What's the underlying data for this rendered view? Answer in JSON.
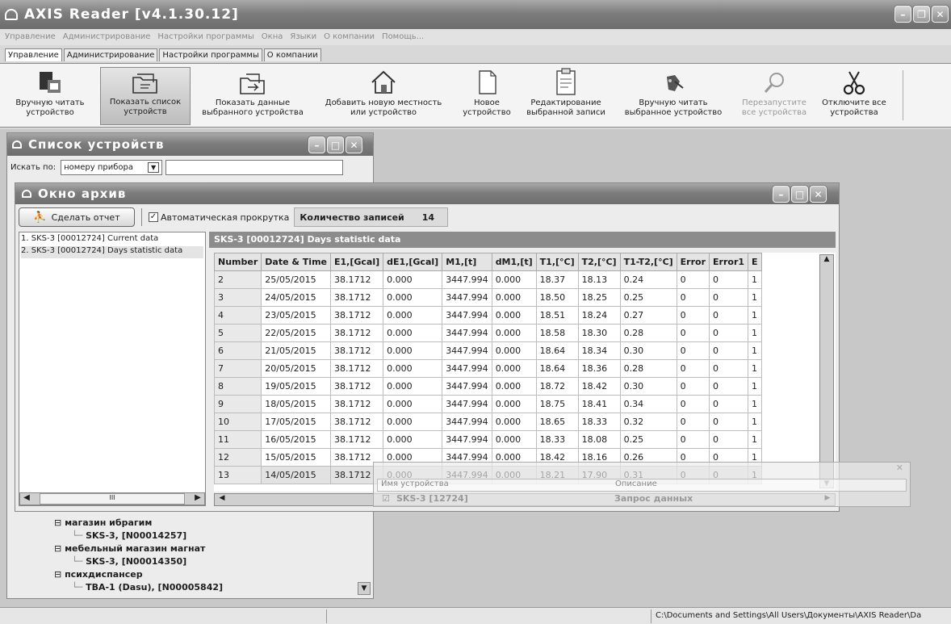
{
  "app": {
    "title": "AXIS Reader [v4.1.30.12]"
  },
  "menu": [
    "Управление",
    "Администрирование",
    "Настройки программы",
    "Окна",
    "Языки",
    "О компании",
    "Помощь..."
  ],
  "tabs": [
    "Управление",
    "Администрирование",
    "Настройки программы",
    "О компании"
  ],
  "toolbar": [
    {
      "l1": "Вручную читать",
      "l2": "устройство",
      "icon": "device-icon",
      "state": "normal"
    },
    {
      "l1": "Показать список",
      "l2": "устройств",
      "icon": "folder-list-icon",
      "state": "selected"
    },
    {
      "l1": "Показать данные",
      "l2": "выбранного устройства",
      "icon": "folder-arrow-icon",
      "state": "normal"
    },
    {
      "l1": "Добавить новую местность",
      "l2": "или устройство",
      "icon": "house-icon",
      "state": "normal"
    },
    {
      "l1": "Новое",
      "l2": "устройство",
      "icon": "document-icon",
      "state": "normal"
    },
    {
      "l1": "Редактирование",
      "l2": "выбранной записи",
      "icon": "clipboard-icon",
      "state": "normal"
    },
    {
      "l1": "Вручную читать",
      "l2": "выбранное устройство",
      "icon": "reader-icon",
      "state": "normal"
    },
    {
      "l1": "Перезапустите",
      "l2": "все устройства",
      "icon": "magnifier-icon",
      "state": "disabled"
    },
    {
      "l1": "Отключите все",
      "l2": "устройства",
      "icon": "scissors-icon",
      "state": "normal"
    }
  ],
  "device_list": {
    "title": "Список устройств",
    "search_label": "Искать по:",
    "search_by": "номеру прибора",
    "tree": [
      {
        "text": "магазин ибрагим",
        "level": 0
      },
      {
        "text": "SKS-3, [N00014257]",
        "level": 1
      },
      {
        "text": "мебельный магазин магнат",
        "level": 0
      },
      {
        "text": "SKS-3, [N00014350]",
        "level": 1
      },
      {
        "text": "психдиспансер",
        "level": 0
      },
      {
        "text": "TBA-1 (Dasu), [N00005842]",
        "level": 1
      }
    ]
  },
  "archive": {
    "title": "Окно архив",
    "report_button": "Сделать отчет",
    "autoscroll_label": "Автоматическая прокрутка",
    "count_label": "Количество записей",
    "count_value": "14",
    "records": [
      "1. SKS-3 [00012724] Current data",
      "2. SKS-3 [00012724] Days statistic data"
    ],
    "grid_title": "SKS-3 [00012724] Days statistic data",
    "columns": [
      "Number",
      "Date & Time",
      "E1,[Gcal]",
      "dE1,[Gcal]",
      "M1,[t]",
      "dM1,[t]",
      "T1,[°C]",
      "T2,[°C]",
      "T1-T2,[°C]",
      "Error",
      "Error1",
      "E"
    ],
    "rows": [
      [
        "2",
        "25/05/2015",
        "38.1712",
        "0.000",
        "3447.994",
        "0.000",
        "18.37",
        "18.13",
        "0.24",
        "0",
        "0",
        "1"
      ],
      [
        "3",
        "24/05/2015",
        "38.1712",
        "0.000",
        "3447.994",
        "0.000",
        "18.50",
        "18.25",
        "0.25",
        "0",
        "0",
        "1"
      ],
      [
        "4",
        "23/05/2015",
        "38.1712",
        "0.000",
        "3447.994",
        "0.000",
        "18.51",
        "18.24",
        "0.27",
        "0",
        "0",
        "1"
      ],
      [
        "5",
        "22/05/2015",
        "38.1712",
        "0.000",
        "3447.994",
        "0.000",
        "18.58",
        "18.30",
        "0.28",
        "0",
        "0",
        "1"
      ],
      [
        "6",
        "21/05/2015",
        "38.1712",
        "0.000",
        "3447.994",
        "0.000",
        "18.64",
        "18.34",
        "0.30",
        "0",
        "0",
        "1"
      ],
      [
        "7",
        "20/05/2015",
        "38.1712",
        "0.000",
        "3447.994",
        "0.000",
        "18.64",
        "18.36",
        "0.28",
        "0",
        "0",
        "1"
      ],
      [
        "8",
        "19/05/2015",
        "38.1712",
        "0.000",
        "3447.994",
        "0.000",
        "18.72",
        "18.42",
        "0.30",
        "0",
        "0",
        "1"
      ],
      [
        "9",
        "18/05/2015",
        "38.1712",
        "0.000",
        "3447.994",
        "0.000",
        "18.75",
        "18.41",
        "0.34",
        "0",
        "0",
        "1"
      ],
      [
        "10",
        "17/05/2015",
        "38.1712",
        "0.000",
        "3447.994",
        "0.000",
        "18.65",
        "18.33",
        "0.32",
        "0",
        "0",
        "1"
      ],
      [
        "11",
        "16/05/2015",
        "38.1712",
        "0.000",
        "3447.994",
        "0.000",
        "18.33",
        "18.08",
        "0.25",
        "0",
        "0",
        "1"
      ],
      [
        "12",
        "15/05/2015",
        "38.1712",
        "0.000",
        "3447.994",
        "0.000",
        "18.42",
        "18.16",
        "0.26",
        "0",
        "0",
        "1"
      ],
      [
        "13",
        "14/05/2015",
        "38.1712",
        "0.000",
        "3447.994",
        "0.000",
        "18.21",
        "17.90",
        "0.31",
        "0",
        "0",
        "1"
      ]
    ]
  },
  "info_panel": {
    "col1": "Имя устройства",
    "col2": "Описание",
    "device": "SKS-3 [12724]",
    "status": "Запрос данных"
  },
  "statusbar": {
    "path": "C:\\Documents and Settings\\All Users\\Документы\\AXIS Reader\\Da"
  },
  "colors": {
    "title_bar": "#7d7d7d",
    "grid_header": "#e4e4e4",
    "workspace": "#c8c8c8"
  }
}
